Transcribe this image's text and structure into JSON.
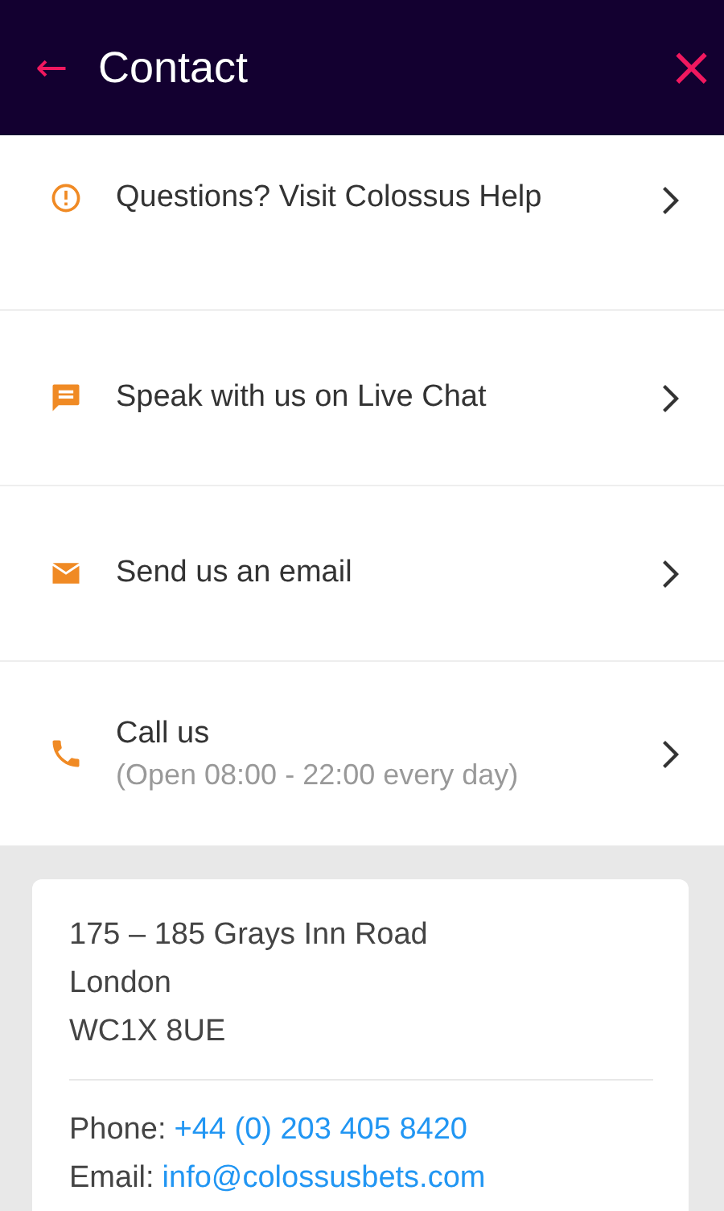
{
  "header": {
    "back": "←",
    "title": "Contact",
    "close": "×"
  },
  "items": [
    {
      "kind": "help",
      "label": "Questions? Visit Colossus Help"
    },
    {
      "kind": "chat",
      "label": "Speak with us on Live Chat"
    },
    {
      "kind": "email",
      "label": "Send us an email"
    },
    {
      "kind": "phone",
      "label": "Call us",
      "subtitle": "(Open 08:00 - 22:00 every day)"
    }
  ],
  "address": [
    "175 – 185 Grays Inn Road",
    "London",
    "WC1X 8UE"
  ],
  "contacts": [
    {
      "label": "Phone:",
      "link": "+44 (0) 203 405 8420"
    },
    {
      "label": "Email:",
      "link": "info@colossusbets.com"
    }
  ]
}
